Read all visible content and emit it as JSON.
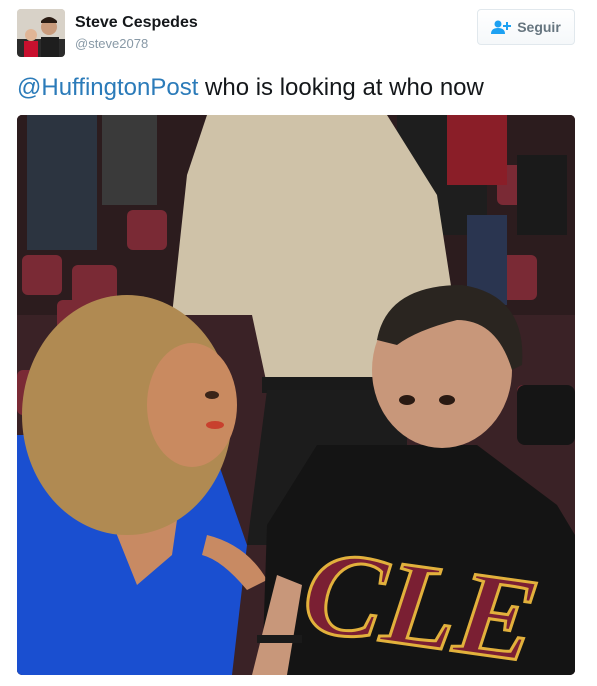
{
  "user": {
    "display_name": "Steve Cespedes",
    "handle": "@steve2078",
    "avatar_icon": "profile-photo"
  },
  "follow_button": {
    "label": "Seguir",
    "icon": "add-user-icon",
    "icon_color": "#1da1f2"
  },
  "tweet": {
    "mention": "@HuffingtonPost",
    "text": " who is looking at who now",
    "mention_color": "#2b7bb9"
  },
  "photo": {
    "shirt_text": "CLE",
    "description_icon": "tweet-photo"
  }
}
